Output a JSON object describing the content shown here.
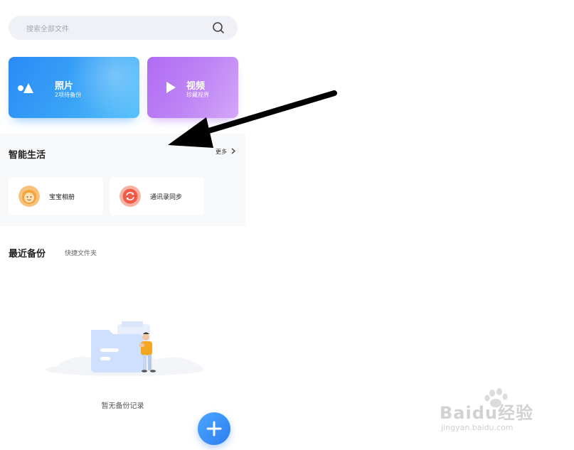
{
  "search": {
    "placeholder": "搜索全部文件",
    "icon": "search-icon"
  },
  "cards": {
    "photo": {
      "title": "照片",
      "subtitle": "2项待备份",
      "icon": "photo-shapes-icon"
    },
    "video": {
      "title": "视频",
      "subtitle": "珍藏视界",
      "icon": "play-icon"
    }
  },
  "smart_life": {
    "title": "智能生活",
    "more": "更多",
    "items": [
      {
        "label": "宝宝相册",
        "icon": "baby-face-icon",
        "color": "#f6a23a"
      },
      {
        "label": "通讯录同步",
        "icon": "contacts-sync-icon",
        "color": "#f05a4a"
      }
    ]
  },
  "recent": {
    "title": "最近备份",
    "tab": "快捷文件夹",
    "empty_text": "暂无备份记录"
  },
  "fab": {
    "icon": "plus-icon"
  },
  "watermark": {
    "text": "Baidu经验",
    "url": "jingyan.baidu.com"
  },
  "colors": {
    "accent": "#2f7df0",
    "photo_card": "#2a8bf5",
    "video_card": "#b06cf3"
  }
}
